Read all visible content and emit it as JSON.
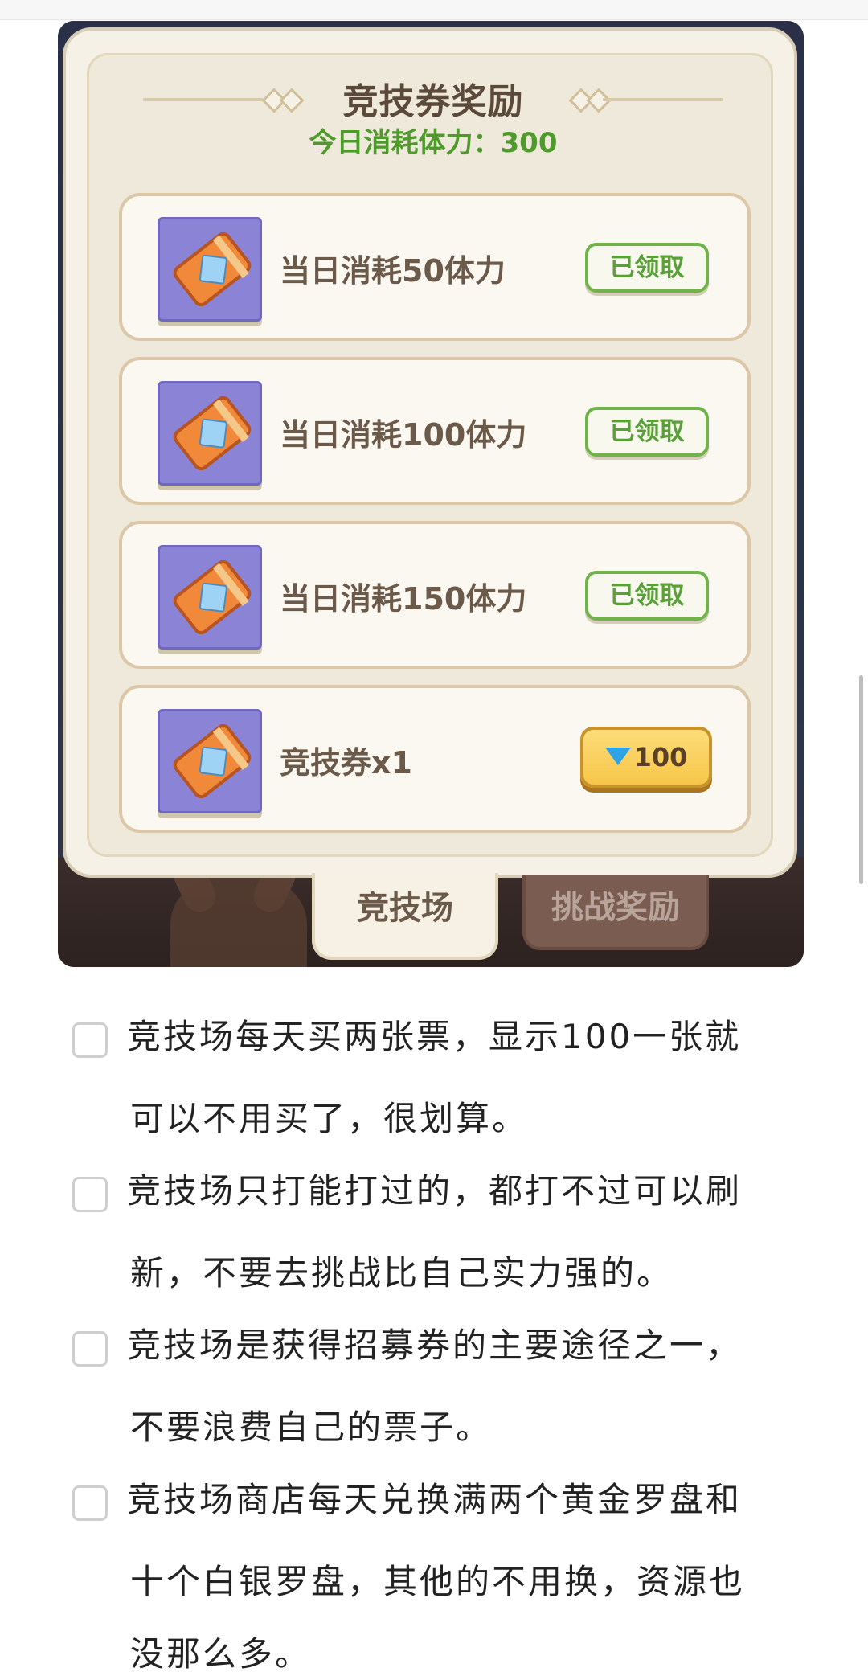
{
  "panel": {
    "title": "竞技券奖励",
    "subtitle": "今日消耗体力：300",
    "rewards": [
      {
        "label": "当日消耗50体力",
        "button": "已领取"
      },
      {
        "label": "当日消耗100体力",
        "button": "已领取"
      },
      {
        "label": "当日消耗150体力",
        "button": "已领取"
      },
      {
        "label": "竞技券x1",
        "button": "100",
        "icon": "gem-icon"
      }
    ],
    "tabs": [
      "竞技场",
      "挑战奖励"
    ]
  },
  "checklist": [
    {
      "lines": [
        " 竞技场每天买两张票，显示100一张就",
        "可以不用买了，很划算。"
      ]
    },
    {
      "lines": [
        " 竞技场只打能打过的，都打不过可以刷",
        "新，不要去挑战比自己实力强的。"
      ]
    },
    {
      "lines": [
        " 竞技场是获得招募券的主要途径之一，",
        "不要浪费自己的票子。"
      ]
    },
    {
      "lines": [
        " 竞技场商店每天兑换满两个黄金罗盘和",
        "十个白银罗盘，其他的不用换，资源也",
        "没那么多。"
      ]
    }
  ],
  "colors": {
    "accent_green": "#4e9a2b",
    "ticket_purple": "#8b84d6",
    "gold_button": "#f6c648"
  }
}
